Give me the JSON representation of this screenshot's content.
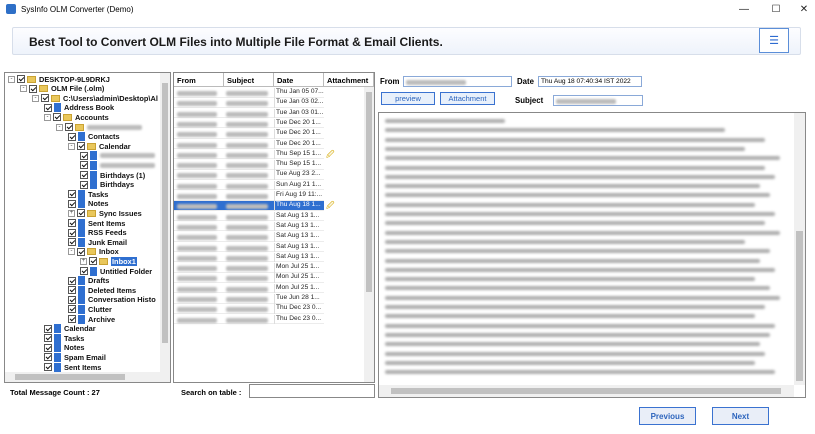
{
  "window": {
    "title": "SysInfo OLM Converter (Demo)",
    "min_label": "—",
    "max_label": "☐",
    "close_label": "✕"
  },
  "header": {
    "tagline": "Best Tool to Convert OLM Files into Multiple File Format & Email Clients.",
    "menu_label": "☰"
  },
  "tree": {
    "nodes": [
      {
        "label": "DESKTOP-9L9DRKJ",
        "depth": 0,
        "type": "computer",
        "expander": "-"
      },
      {
        "label": "OLM File (.olm)",
        "depth": 1,
        "type": "folder",
        "expander": "-"
      },
      {
        "label": "C:\\Users\\admin\\Desktop\\Al",
        "depth": 2,
        "type": "folder",
        "expander": "-"
      },
      {
        "label": "Address Book",
        "depth": 3,
        "type": "book",
        "expander": ""
      },
      {
        "label": "Accounts",
        "depth": 3,
        "type": "folder",
        "expander": "-"
      },
      {
        "label": "",
        "depth": 4,
        "type": "folder",
        "expander": "-",
        "blurred": true
      },
      {
        "label": "Contacts",
        "depth": 5,
        "type": "book",
        "expander": ""
      },
      {
        "label": "Calendar",
        "depth": 5,
        "type": "folder",
        "expander": "-"
      },
      {
        "label": "",
        "depth": 6,
        "type": "book",
        "expander": "",
        "blurred": true
      },
      {
        "label": "",
        "depth": 6,
        "type": "book",
        "expander": "",
        "blurred": true
      },
      {
        "label": "Birthdays (1)",
        "depth": 6,
        "type": "book",
        "expander": ""
      },
      {
        "label": "Birthdays",
        "depth": 6,
        "type": "book",
        "expander": ""
      },
      {
        "label": "Tasks",
        "depth": 5,
        "type": "book",
        "expander": ""
      },
      {
        "label": "Notes",
        "depth": 5,
        "type": "book",
        "expander": ""
      },
      {
        "label": "Sync Issues",
        "depth": 5,
        "type": "folder",
        "expander": "+"
      },
      {
        "label": "Sent Items",
        "depth": 5,
        "type": "book",
        "expander": ""
      },
      {
        "label": "RSS Feeds",
        "depth": 5,
        "type": "book",
        "expander": ""
      },
      {
        "label": "Junk Email",
        "depth": 5,
        "type": "book",
        "expander": ""
      },
      {
        "label": "Inbox",
        "depth": 5,
        "type": "folder",
        "expander": "-"
      },
      {
        "label": "Inbox1",
        "depth": 6,
        "type": "folder",
        "expander": "+",
        "selected": true
      },
      {
        "label": "Untitled Folder",
        "depth": 6,
        "type": "book",
        "expander": ""
      },
      {
        "label": "Drafts",
        "depth": 5,
        "type": "book",
        "expander": ""
      },
      {
        "label": "Deleted Items",
        "depth": 5,
        "type": "book",
        "expander": ""
      },
      {
        "label": "Conversation Histo",
        "depth": 5,
        "type": "book",
        "expander": ""
      },
      {
        "label": "Clutter",
        "depth": 5,
        "type": "book",
        "expander": ""
      },
      {
        "label": "Archive",
        "depth": 5,
        "type": "book",
        "expander": ""
      },
      {
        "label": "Calendar",
        "depth": 3,
        "type": "book",
        "expander": ""
      },
      {
        "label": "Tasks",
        "depth": 3,
        "type": "book",
        "expander": ""
      },
      {
        "label": "Notes",
        "depth": 3,
        "type": "book",
        "expander": ""
      },
      {
        "label": "Spam Email",
        "depth": 3,
        "type": "book",
        "expander": ""
      },
      {
        "label": "Sent Items",
        "depth": 3,
        "type": "book",
        "expander": ""
      }
    ]
  },
  "message_list": {
    "headers": {
      "from": "From",
      "subject": "Subject",
      "date": "Date",
      "attachment": "Attachment"
    },
    "rows": [
      {
        "date": "Thu Jan 05 07...",
        "attach": false,
        "selected": false
      },
      {
        "date": "Tue Jan 03 02...",
        "attach": false,
        "selected": false
      },
      {
        "date": "Tue Jan 03 01...",
        "attach": false,
        "selected": false
      },
      {
        "date": "Tue Dec 20 1...",
        "attach": false,
        "selected": false
      },
      {
        "date": "Tue Dec 20 1...",
        "attach": false,
        "selected": false
      },
      {
        "date": "Tue Dec 20 1...",
        "attach": false,
        "selected": false
      },
      {
        "date": "Thu Sep 15 1...",
        "attach": true,
        "selected": false
      },
      {
        "date": "Thu Sep 15 1...",
        "attach": false,
        "selected": false
      },
      {
        "date": "Tue Aug 23 2...",
        "attach": false,
        "selected": false
      },
      {
        "date": "Sun Aug 21 1...",
        "attach": false,
        "selected": false
      },
      {
        "date": "Fri Aug 19 11:...",
        "attach": false,
        "selected": false
      },
      {
        "date": "Thu Aug 18 1...",
        "attach": true,
        "selected": true
      },
      {
        "date": "Sat Aug 13 1...",
        "attach": false,
        "selected": false
      },
      {
        "date": "Sat Aug 13 1...",
        "attach": false,
        "selected": false
      },
      {
        "date": "Sat Aug 13 1...",
        "attach": false,
        "selected": false
      },
      {
        "date": "Sat Aug 13 1...",
        "attach": false,
        "selected": false
      },
      {
        "date": "Sat Aug 13 1...",
        "attach": false,
        "selected": false
      },
      {
        "date": "Mon Jul 25 1...",
        "attach": false,
        "selected": false
      },
      {
        "date": "Mon Jul 25 1...",
        "attach": false,
        "selected": false
      },
      {
        "date": "Mon Jul 25 1...",
        "attach": false,
        "selected": false
      },
      {
        "date": "Tue Jun 28 1...",
        "attach": false,
        "selected": false
      },
      {
        "date": "Thu Dec 23 0...",
        "attach": false,
        "selected": false
      },
      {
        "date": "Thu Dec 23 0...",
        "attach": false,
        "selected": false
      }
    ]
  },
  "status": {
    "message_count": "Total Message Count : 27",
    "search_label": "Search on table :",
    "search_value": ""
  },
  "preview": {
    "from_label": "From",
    "date_label": "Date",
    "date_value": "Thu Aug 18 07:40:34 IST 2022",
    "subject_label": "Subject",
    "preview_btn": "preview",
    "attachment_btn": "Attachment"
  },
  "nav": {
    "previous": "Previous",
    "next": "Next"
  },
  "colors": {
    "accent": "#2f6fd0",
    "folder": "#e9c75b",
    "selection": "#2f6fd0"
  }
}
